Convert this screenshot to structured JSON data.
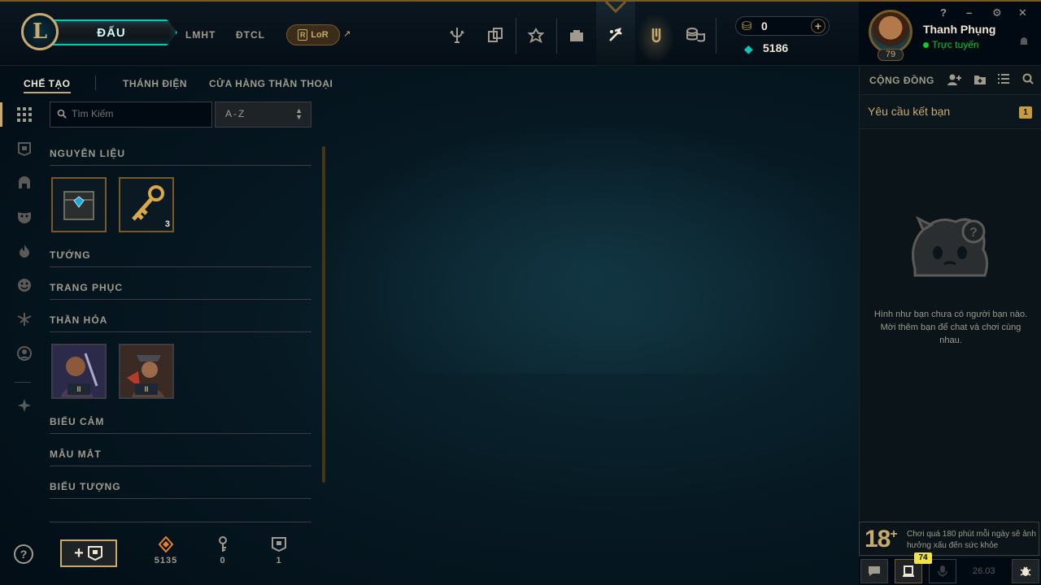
{
  "topbar": {
    "play_label": "ĐẤU",
    "logo_letter": "L",
    "nav_links": [
      "LMHT",
      "ĐTCL"
    ],
    "lor_label": "LoR",
    "lor_ext": "↗",
    "nav_icons": [
      "home-trident-icon",
      "tft-icon",
      "clash-icon",
      "collection-icon",
      "loot-crafting-icon",
      "store-icon",
      "currency-store-icon"
    ]
  },
  "currency": {
    "rp": "0",
    "blue_essence": "5186",
    "add": "+"
  },
  "profile": {
    "name": "Thanh Phụng",
    "status": "Trực tuyến",
    "level": "79"
  },
  "window_controls": [
    "?",
    "–",
    "⚙",
    "✕"
  ],
  "subtabs": {
    "crafting": "CHẾ TẠO",
    "sanctum": "THÁNH ĐIỆN",
    "mythic_shop": "CỬA HÀNG THẦN THOẠI"
  },
  "search": {
    "placeholder": "Tìm Kiếm"
  },
  "sort": {
    "value": "A-Z",
    "chevron": "⌃⌄"
  },
  "sections": {
    "materials": "NGUYÊN LIỆU",
    "champions": "TƯỚNG",
    "skins": "TRANG PHỤC",
    "eternals": "THẦN HỎA",
    "emotes": "BIỂU CẢM",
    "ward_skins": "MẪU MẮT",
    "icons": "BIỂU TƯỢNG"
  },
  "materials": [
    {
      "name": "hextech-chest",
      "count": ""
    },
    {
      "name": "hextech-key",
      "count": "3"
    }
  ],
  "eternals": [
    {
      "name": "eternal-series-2-a",
      "badge": "II"
    },
    {
      "name": "eternal-series-2-b",
      "badge": "II"
    }
  ],
  "bottom": {
    "help": "?",
    "add_chest": "+",
    "orange_essence": "5135",
    "keys": "0",
    "chests": "1"
  },
  "social": {
    "title": "CỘNG ĐỒNG",
    "friend_requests": "Yêu cầu kết bạn",
    "friend_request_count": "1",
    "empty_message": "Hình như bạn chưa có người bạn nào. Mời thêm bạn để chat và chơi cùng nhau.",
    "age_rating": "18",
    "age_plus": "+",
    "age_warning": "Chơi quá 180 phút mỗi ngày sẽ ảnh hưởng xấu đến sức khỏe",
    "notification_count": "74",
    "patch": "26.03"
  },
  "colors": {
    "gold": "#c8aa6e",
    "teal": "#0ac8b9",
    "online": "#0acb30",
    "badge_yellow": "#f2e24a"
  }
}
